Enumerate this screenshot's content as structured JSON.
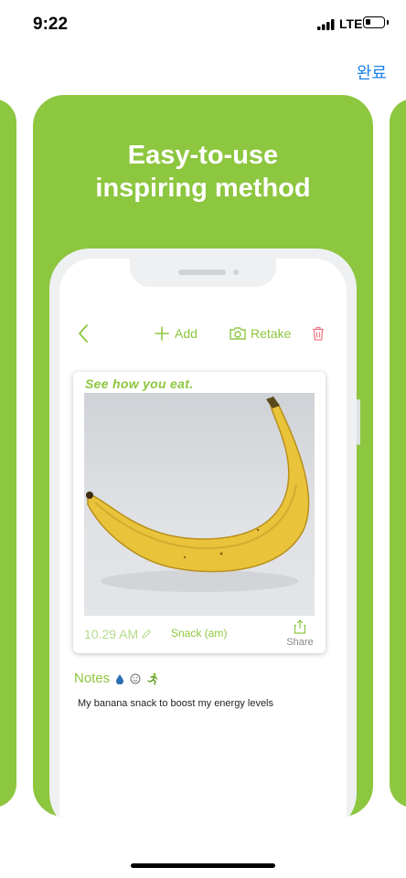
{
  "status_bar": {
    "time": "9:22",
    "network": "LTE"
  },
  "nav": {
    "done_label": "완료"
  },
  "screenshot": {
    "headline_line1": "Easy-to-use",
    "headline_line2": "inspiring method",
    "brand_color": "#8dc63f"
  },
  "app": {
    "toolbar": {
      "add_label": "Add",
      "retake_label": "Retake"
    },
    "photo_card": {
      "title": "See how you eat.",
      "time": "10.29 AM",
      "meal": "Snack (am)",
      "share_label": "Share"
    },
    "notes": {
      "label": "Notes",
      "text": "My banana snack to boost my energy levels"
    }
  },
  "icons": [
    "signal-icon",
    "battery-icon",
    "back-chevron-icon",
    "plus-icon",
    "camera-icon",
    "trash-icon",
    "pencil-icon",
    "share-icon",
    "water-drop-icon",
    "smiley-icon",
    "runner-icon"
  ]
}
